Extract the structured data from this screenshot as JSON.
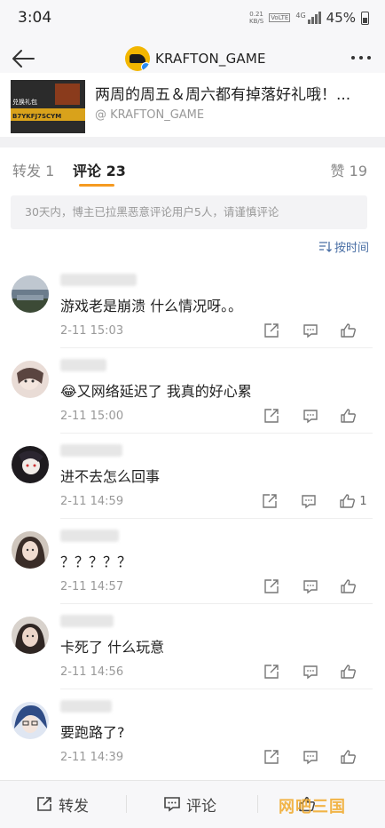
{
  "status_bar": {
    "time": "3:04",
    "net_speed_top": "0.21",
    "net_speed_bottom": "KB/S",
    "volte": "VoLTE",
    "network": "4G",
    "battery": "45%"
  },
  "nav": {
    "account_name": "KRAFTON_GAME"
  },
  "post": {
    "thumb_text": "兑换礼包",
    "thumb_code": "B7YKFJ7SCYM",
    "text": "两周的周五＆周六都有掉落好礼哦！...",
    "author": "@ KRAFTON_GAME"
  },
  "tabs": {
    "repost": "转发 1",
    "comment": "评论 23",
    "like": "赞 19"
  },
  "notice": "30天内，博主已拉黑恶意评论用户5人，请谨慎评论",
  "sort_label": "按时间",
  "comments": [
    {
      "text": "游戏老是崩溃  什么情况呀。。",
      "time": "2-11 15:03",
      "likes": ""
    },
    {
      "text": "😂又网络延迟了 我真的好心累",
      "time": "2-11 15:00",
      "likes": ""
    },
    {
      "text": "进不去怎么回事",
      "time": "2-11 14:59",
      "likes": "1"
    },
    {
      "text": "？？？？？",
      "time": "2-11 14:57",
      "likes": ""
    },
    {
      "text": "卡死了 什么玩意",
      "time": "2-11 14:56",
      "likes": ""
    },
    {
      "text": "要跑路了?",
      "time": "2-11 14:39",
      "likes": ""
    }
  ],
  "bottom_bar": {
    "repost": "转发",
    "comment": "评论"
  },
  "watermark": "网吧三国",
  "colors": {
    "accent": "#f59a21",
    "link": "#4a6fa5",
    "verified": "#2a8cf5"
  }
}
